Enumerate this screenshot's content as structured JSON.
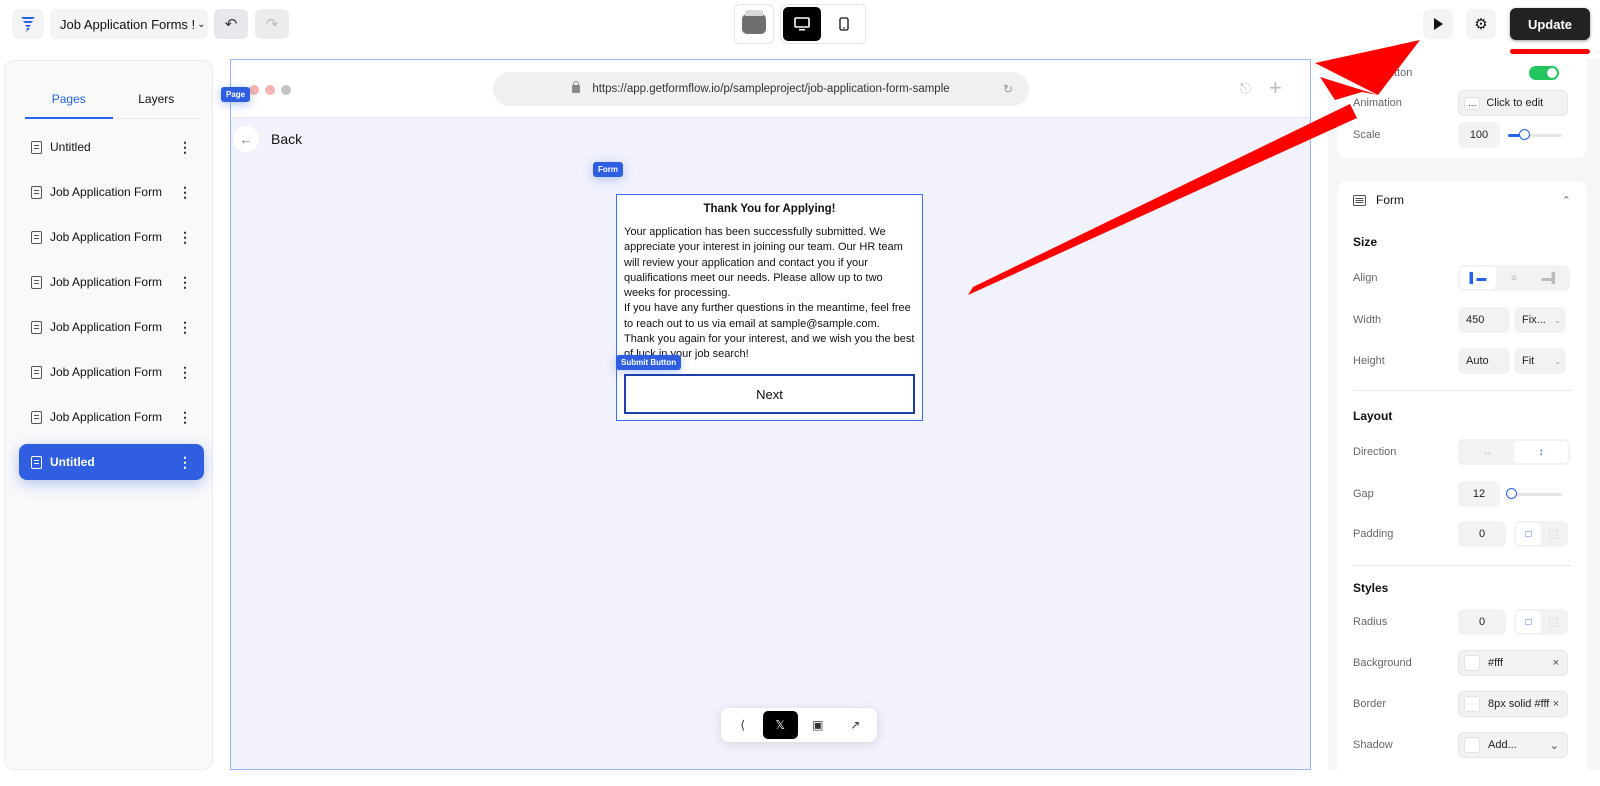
{
  "topbar": {
    "project_name": "Job Application Forms !",
    "undo_icon": "undo-icon",
    "redo_icon": "redo-icon",
    "theme_icon": "theme-icon",
    "devices": [
      {
        "name": "desktop",
        "icon": "desktop-icon",
        "active": true
      },
      {
        "name": "mobile",
        "icon": "mobile-icon",
        "active": false
      }
    ],
    "preview_icon": "play-icon",
    "settings_icon": "gear-icon",
    "update_label": "Update"
  },
  "sidebar": {
    "tabs": [
      {
        "label": "Pages",
        "active": true
      },
      {
        "label": "Layers",
        "active": false
      }
    ],
    "pages": [
      {
        "label": "Untitled",
        "active": false
      },
      {
        "label": "Job Application Form",
        "active": false
      },
      {
        "label": "Job Application Form",
        "active": false
      },
      {
        "label": "Job Application Form",
        "active": false
      },
      {
        "label": "Job Application Form",
        "active": false
      },
      {
        "label": "Job Application Form",
        "active": false
      },
      {
        "label": "Job Application Form",
        "active": false
      },
      {
        "label": "Untitled",
        "active": true
      }
    ]
  },
  "canvas": {
    "page_tag": "Page",
    "url": "https://app.getformflow.io/p/sampleproject/job-application-form-sample",
    "back_label": "Back",
    "form_tag": "Form",
    "submit_tag": "Submit Button",
    "form": {
      "title": "Thank You for Applying!",
      "paragraphs": [
        "Your application has been successfully submitted. We appreciate your interest in joining our team. Our HR team will review your application and contact you if your qualifications meet our needs. Please allow up to two weeks for processing.",
        "If you have any further questions in the meantime, feel free to reach out to us via email at sample@sample.com.",
        "Thank you again for your interest, and we wish you the best of luck in your job search!"
      ],
      "button_label": "Next"
    },
    "bottom_toolbar": [
      {
        "icon": "share-nodes-icon",
        "active": false
      },
      {
        "icon": "x-logo-icon",
        "active": true
      },
      {
        "icon": "embed-icon",
        "active": false
      },
      {
        "icon": "export-icon",
        "active": false
      }
    ]
  },
  "properties": {
    "top_card": {
      "back_button_label": "Back Button",
      "back_button_enabled": true,
      "animation_label": "Animation",
      "animation_value": "Click to edit",
      "animation_prefix": "...",
      "scale_label": "Scale",
      "scale_value": "100",
      "scale_fraction": 0.3
    },
    "form_card": {
      "title": "Form",
      "size_title": "Size",
      "align_label": "Align",
      "align_options": [
        "left",
        "center",
        "right"
      ],
      "align_selected": "left",
      "width_label": "Width",
      "width_value": "450",
      "width_mode": "Fix...",
      "height_label": "Height",
      "height_value": "Auto",
      "height_mode": "Fit",
      "layout_title": "Layout",
      "direction_label": "Direction",
      "direction_options": [
        "horizontal",
        "vertical"
      ],
      "direction_selected": "vertical",
      "gap_label": "Gap",
      "gap_value": "12",
      "gap_fraction": 0.05,
      "padding_label": "Padding",
      "padding_value": "0",
      "styles_title": "Styles",
      "radius_label": "Radius",
      "radius_value": "0",
      "background_label": "Background",
      "background_value": "#fff",
      "border_label": "Border",
      "border_value": "8px solid #fff",
      "shadow_label": "Shadow",
      "shadow_value": "Add..."
    }
  },
  "colors": {
    "accent": "#2563eb",
    "selected_page": "#2f5fe0",
    "update_button": "#222222",
    "annotation_arrow": "#ff0000",
    "toggle_on": "#22c55e"
  }
}
